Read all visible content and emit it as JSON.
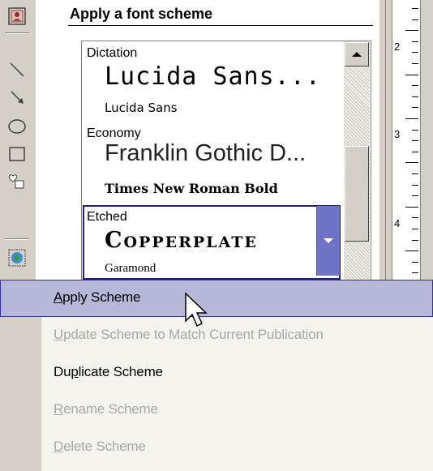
{
  "task_pane": {
    "title": "Apply a font scheme"
  },
  "schemes": [
    {
      "name": "Dictation",
      "major": "Lucida Sans...",
      "minor": "Lucida Sans"
    },
    {
      "name": "Economy",
      "major": "Franklin Gothic D...",
      "minor": "Times New Roman Bold"
    },
    {
      "name": "Etched",
      "major": "Copperplate",
      "minor": "Garamond",
      "selected": true
    }
  ],
  "ruler": {
    "numbers": [
      "2",
      "3",
      "4"
    ]
  },
  "context_menu": {
    "items": [
      {
        "pre": "",
        "ul": "A",
        "post": "pply Scheme",
        "state": "highlighted"
      },
      {
        "pre": "",
        "ul": "U",
        "post": "pdate Scheme to Match Current Publication",
        "state": "disabled"
      },
      {
        "pre": "Du",
        "ul": "p",
        "post": "licate Scheme",
        "state": "enabled"
      },
      {
        "pre": "",
        "ul": "R",
        "post": "ename Scheme",
        "state": "disabled"
      },
      {
        "pre": "",
        "ul": "D",
        "post": "elete Scheme",
        "state": "disabled"
      }
    ]
  },
  "colors": {
    "menu_highlight": "#b6b7d9",
    "menu_highlight_border": "#34349a",
    "selection_border": "#1c1c8c",
    "dropdown_button": "#6f73c6"
  },
  "icons": [
    "picture-frame-icon",
    "line-icon",
    "arrow-icon",
    "oval-icon",
    "rectangle-icon",
    "autoshapes-icon",
    "design-gallery-icon",
    "scroll-up-arrow-icon",
    "dropdown-arrow-icon",
    "mouse-pointer-icon"
  ]
}
